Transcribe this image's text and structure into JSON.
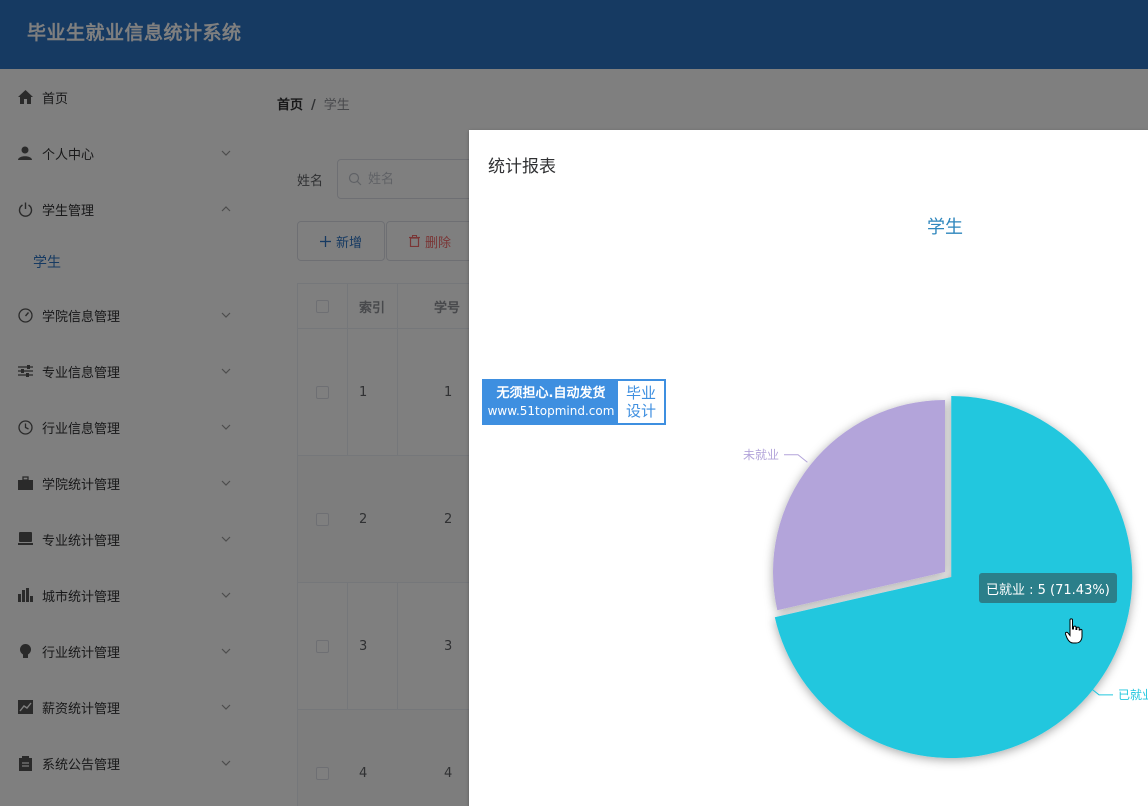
{
  "app": {
    "title": "毕业生就业信息统计系统"
  },
  "sidebar": {
    "items": [
      {
        "label": "首页",
        "icon": "home-icon",
        "has_arrow": false
      },
      {
        "label": "个人中心",
        "icon": "user-icon",
        "has_arrow": true
      },
      {
        "label": "学生管理",
        "icon": "power-icon",
        "has_arrow": true,
        "expanded": true
      },
      {
        "label": "学生",
        "icon": "",
        "sub": true
      },
      {
        "label": "学院信息管理",
        "icon": "gauge-icon",
        "has_arrow": true
      },
      {
        "label": "专业信息管理",
        "icon": "sliders-icon",
        "has_arrow": true
      },
      {
        "label": "行业信息管理",
        "icon": "clock-icon",
        "has_arrow": true
      },
      {
        "label": "学院统计管理",
        "icon": "briefcase-icon",
        "has_arrow": true
      },
      {
        "label": "专业统计管理",
        "icon": "monitor-icon",
        "has_arrow": true
      },
      {
        "label": "城市统计管理",
        "icon": "bar-chart-icon",
        "has_arrow": true
      },
      {
        "label": "行业统计管理",
        "icon": "bulb-icon",
        "has_arrow": true
      },
      {
        "label": "薪资统计管理",
        "icon": "trend-chart-icon",
        "has_arrow": true
      },
      {
        "label": "系统公告管理",
        "icon": "clipboard-icon",
        "has_arrow": true
      }
    ]
  },
  "breadcrumb": {
    "home": "首页",
    "separator": "/",
    "current": "学生"
  },
  "search": {
    "label": "姓名",
    "placeholder": "姓名"
  },
  "toolbar": {
    "add_label": "新增",
    "delete_label": "删除"
  },
  "table": {
    "headers": [
      "索引",
      "学号"
    ],
    "rows": [
      {
        "index": "1",
        "student_no": "1"
      },
      {
        "index": "2",
        "student_no": "2"
      },
      {
        "index": "3",
        "student_no": "3"
      },
      {
        "index": "4",
        "student_no": "4"
      }
    ]
  },
  "dialog": {
    "title": "统计报表"
  },
  "watermark": {
    "line1": "无须担心.自动发货",
    "line2": "www.51topmind.com",
    "right1": "毕业",
    "right2": "设计"
  },
  "chart_data": {
    "type": "pie",
    "title": "学生",
    "slices": [
      {
        "name": "已就业",
        "value": 5,
        "percent": 71.43,
        "color": "#22c7de"
      },
      {
        "name": "未就业",
        "value": 2,
        "percent": 28.57,
        "color": "#b3a4da"
      }
    ],
    "tooltip": "已就业 : 5 (71.43%)"
  },
  "colors": {
    "primary": "#2d74c4",
    "danger": "#f56c6c",
    "title": "#2d86bd"
  }
}
